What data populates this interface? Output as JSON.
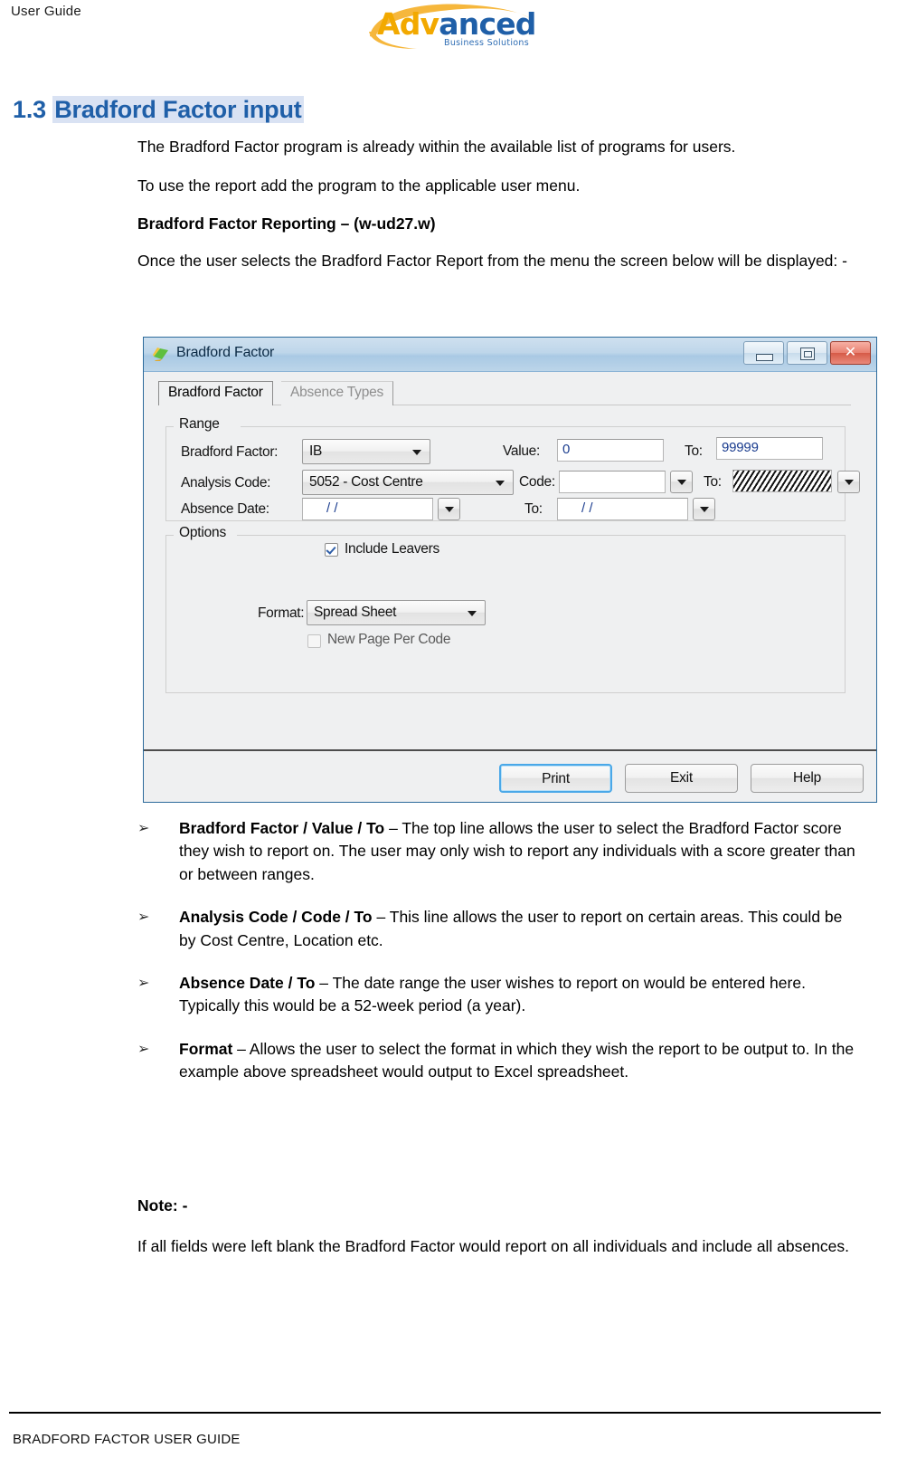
{
  "header": {
    "left_label": "User Guide",
    "logo": {
      "word_part1": "Adv",
      "word_part2": "anced",
      "tagline": "Business Solutions",
      "color_gold": "#F2A900",
      "color_blue": "#1F5FA8"
    }
  },
  "heading": {
    "number": "1.3",
    "title": "Bradford Factor input",
    "color": "#1F5FA8",
    "highlight": "#D9E2F3"
  },
  "intro": {
    "para1": "The Bradford Factor program is already within the available list of programs for users.",
    "para2": "To use the report add the program to the applicable user menu.",
    "para3_bold": "Bradford Factor Reporting – (w-ud27.w)",
    "para4": "Once the user selects the Bradford Factor Report from the menu the screen below will be displayed: -"
  },
  "dialog": {
    "title": "Bradford Factor",
    "window_buttons": {
      "minimize": "minimize-icon",
      "restore": "restore-icon",
      "close": "✕"
    },
    "tabs": [
      {
        "label": "Bradford Factor",
        "active": true
      },
      {
        "label": "Absence Types",
        "active": false
      }
    ],
    "range_group": {
      "legend": "Range",
      "bradford_factor_label": "Bradford Factor:",
      "bradford_factor_value": "IB",
      "value_label": "Value:",
      "value_value": "0",
      "value_to_label": "To:",
      "value_to_value": "99999",
      "analysis_code_label": "Analysis Code:",
      "analysis_code_value": "5052 - Cost Centre",
      "code_label": "Code:",
      "code_value": "",
      "code_to_label": "To:",
      "code_to_value": "",
      "absence_date_label": "Absence Date:",
      "absence_date_value": "/      /",
      "absence_date_to_label": "To:",
      "absence_date_to_value": "/      /",
      "include_leavers_label": "Include Leavers",
      "include_leavers_checked": true
    },
    "options_group": {
      "legend": "Options",
      "format_label": "Format:",
      "format_value": "Spread Sheet",
      "new_page_label": "New Page Per Code",
      "new_page_checked": false
    },
    "buttons": {
      "print": "Print",
      "exit": "Exit",
      "help": "Help"
    }
  },
  "bullets": [
    {
      "marker": "➢",
      "bold": "Bradford Factor / Value / To",
      "rest": " – The top line allows the user to select the Bradford Factor score they wish to report on. The user may only wish to report any individuals with a score greater than or between ranges."
    },
    {
      "marker": "➢",
      "bold": "Analysis Code / Code / To",
      "rest": " – This line allows the user to report on certain areas. This could be by Cost Centre, Location etc."
    },
    {
      "marker": "➢",
      "bold": "Absence Date / To",
      "rest": " – The date range the user wishes to report on would be entered here. Typically this would be a 52-week period (a year)."
    },
    {
      "marker": "➢",
      "bold": "Format",
      "rest": " – Allows the user to select the format in which they wish the report to be output to. In the example above spreadsheet would output to Excel spreadsheet."
    }
  ],
  "note": {
    "title": "Note: -",
    "body": "If all fields were left blank the Bradford Factor would report on all individuals and include all absences."
  },
  "footer": {
    "text": "BRADFORD FACTOR USER GUIDE"
  }
}
